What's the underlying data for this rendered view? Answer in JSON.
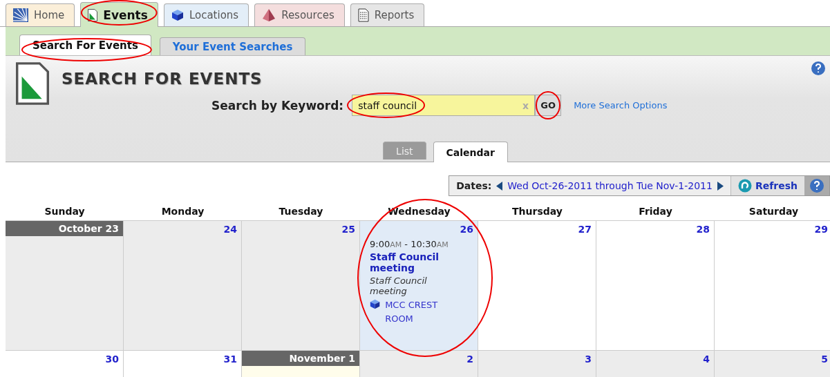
{
  "main_tabs": [
    {
      "label": "Home",
      "selected": false,
      "circled": false
    },
    {
      "label": "Events",
      "selected": true,
      "circled": true
    },
    {
      "label": "Locations",
      "selected": false,
      "circled": false
    },
    {
      "label": "Resources",
      "selected": false,
      "circled": false
    },
    {
      "label": "Reports",
      "selected": false,
      "circled": false
    }
  ],
  "sub_tabs": [
    {
      "label": "Search For Events",
      "selected": true,
      "circled": true
    },
    {
      "label": "Your Event Searches",
      "selected": false,
      "circled": false
    }
  ],
  "header": {
    "title": "SEARCH FOR EVENTS",
    "search_label": "Search by Keyword:",
    "search_value": "staff council",
    "search_circled": true,
    "clear": "x",
    "go": "GO",
    "go_circled": true,
    "more": "More Search Options"
  },
  "view_tabs": [
    {
      "label": "List",
      "selected": false
    },
    {
      "label": "Calendar",
      "selected": true
    }
  ],
  "dates_bar": {
    "label": "Dates:",
    "range": "Wed Oct-26-2011 through Tue Nov-1-2011",
    "refresh": "Refresh"
  },
  "weekdays": [
    "Sunday",
    "Monday",
    "Tuesday",
    "Wednesday",
    "Thursday",
    "Friday",
    "Saturday"
  ],
  "weeks": [
    [
      {
        "day": "October 23",
        "kind": "shaded",
        "month_start": true
      },
      {
        "day": "24",
        "kind": "shaded",
        "month_start": false
      },
      {
        "day": "25",
        "kind": "shaded",
        "month_start": false
      },
      {
        "day": "26",
        "kind": "selected",
        "month_start": false,
        "circled": true,
        "events": [
          {
            "start": "9:00",
            "start_suffix": "AM",
            "separator": "-",
            "end": "10:30",
            "end_suffix": "AM",
            "title": "Staff Council meeting",
            "description": "Staff Council meeting",
            "location": "MCC CREST ROOM"
          }
        ]
      },
      {
        "day": "27",
        "kind": "plain",
        "month_start": false
      },
      {
        "day": "28",
        "kind": "plain",
        "month_start": false
      },
      {
        "day": "29",
        "kind": "plain",
        "month_start": false
      }
    ],
    [
      {
        "day": "30",
        "kind": "plain",
        "month_start": false
      },
      {
        "day": "31",
        "kind": "plain",
        "month_start": false
      },
      {
        "day": "November 1",
        "kind": "today",
        "month_start": true
      },
      {
        "day": "2",
        "kind": "shaded",
        "month_start": false
      },
      {
        "day": "3",
        "kind": "shaded",
        "month_start": false
      },
      {
        "day": "4",
        "kind": "shaded",
        "month_start": false
      },
      {
        "day": "5",
        "kind": "shaded",
        "month_start": false
      }
    ]
  ]
}
